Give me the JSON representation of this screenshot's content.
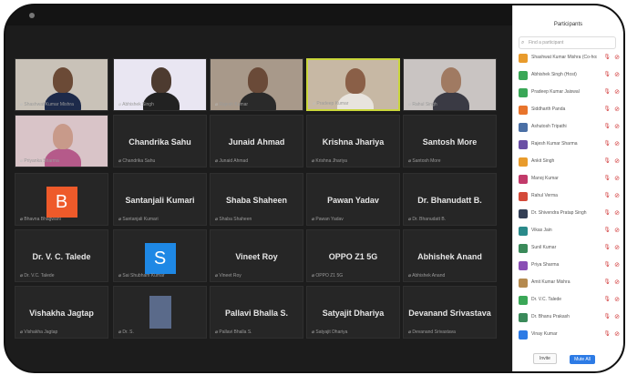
{
  "participants_panel": {
    "title": "Participants",
    "search_placeholder": "Find a participant",
    "rows": [
      {
        "name": "Shashwat Kumar Mishra (Co-host)",
        "color": "#e89b2c"
      },
      {
        "name": "Abhishek Singh (Host)",
        "color": "#3aa757"
      },
      {
        "name": "Pradeep Kumar Jaiswal",
        "color": "#3aa757"
      },
      {
        "name": "Siddharth Panda",
        "color": "#e8742c"
      },
      {
        "name": "Ashutosh Tripathi",
        "color": "#4a6fa5"
      },
      {
        "name": "Rajesh Kumar Sharma",
        "color": "#6a4fa5"
      },
      {
        "name": "Ankit Singh",
        "color": "#e89b2c"
      },
      {
        "name": "Manoj Kumar",
        "color": "#c23a6a"
      },
      {
        "name": "Rahul Verma",
        "color": "#d44a3a"
      },
      {
        "name": "Dr. Shivendra Pratap Singh",
        "color": "#333f55"
      },
      {
        "name": "Vikas Jain",
        "color": "#2a8a8a"
      },
      {
        "name": "Sunil Kumar",
        "color": "#3a8a5a"
      },
      {
        "name": "Priya Sharma",
        "color": "#8a4fb5"
      },
      {
        "name": "Amit Kumar Mishra",
        "color": "#b58a4f"
      },
      {
        "name": "Dr. V.C. Talede",
        "color": "#3aa757"
      },
      {
        "name": "Dr. Bhanu Prakash",
        "color": "#3a8a5a"
      },
      {
        "name": "Vinay Kumar",
        "color": "#2d7be5"
      }
    ],
    "invite_label": "Invite",
    "mute_all_label": "Mute All"
  },
  "video_tiles": [
    {
      "sub": "Shashwat Kumar Mishra",
      "bg": "#c9c2b8",
      "skin": "#6b4a36",
      "shirt": "#1d2a4a"
    },
    {
      "sub": "Abhishek Singh",
      "bg": "#e9e6f2",
      "skin": "#4d3b30",
      "shirt": "#222222"
    },
    {
      "sub": "Rajesh Kumar",
      "bg": "#a8998a",
      "skin": "#6a4a38",
      "shirt": "#2a2a2a"
    },
    {
      "sub": "Pradeep Kumar",
      "bg": "#c7b8a4",
      "skin": "#8a5f47",
      "shirt": "#e8e4de"
    },
    {
      "sub": "Rahul Singh",
      "bg": "#c9c4c2",
      "skin": "#a07a62",
      "shirt": "#3a3a44"
    },
    {
      "sub": "Priyanka Sharma",
      "bg": "#d9c4c8",
      "skin": "#c89a8a",
      "shirt": "#b55a8a"
    }
  ],
  "name_tiles": [
    {
      "name": "Chandrika Sahu",
      "sub": "Chandrika Sahu"
    },
    {
      "name": "Junaid Ahmad",
      "sub": "Junaid Ahmad"
    },
    {
      "name": "Krishna Jhariya",
      "sub": "Krishna Jhariya"
    },
    {
      "name": "Santosh More",
      "sub": "Santosh More"
    },
    {
      "name": "Santanjali Kumari",
      "sub": "Santanjali Kumari"
    },
    {
      "name": "Shaba Shaheen",
      "sub": "Shaba Shaheen"
    },
    {
      "name": "Pawan Yadav",
      "sub": "Pawan Yadav"
    },
    {
      "name": "Dr. Bhanudatt B.",
      "sub": "Dr. Bhanudatt B."
    },
    {
      "name": "Dr. V. C. Talede",
      "sub": "Dr. V.C. Talede"
    },
    {
      "name": "Vineet Roy",
      "sub": "Vineet Roy"
    },
    {
      "name": "OPPO Z1 5G",
      "sub": "OPPO Z1 5G"
    },
    {
      "name": "Abhishek Anand",
      "sub": "Abhishek Anand"
    },
    {
      "name": "Vishakha Jagtap",
      "sub": "Vishakha Jagtap"
    },
    {
      "name": "Pallavi Bhalla S.",
      "sub": "Pallavi Bhalla S."
    },
    {
      "name": "Satyajit Dhariya",
      "sub": "Satyajit Dhariya"
    },
    {
      "name": "Devanand Srivastava",
      "sub": "Devanand Srivastava"
    }
  ],
  "avatar_tiles": [
    {
      "letter": "B",
      "sub": "Bhavna Bhagwani",
      "color": "#ee5a2a"
    },
    {
      "letter": "S",
      "sub": "Sai Shubham Kumar",
      "color": "#1e88e5"
    },
    {
      "letter": "",
      "sub": "Dr. S.",
      "color": "#5a6a8a"
    }
  ]
}
